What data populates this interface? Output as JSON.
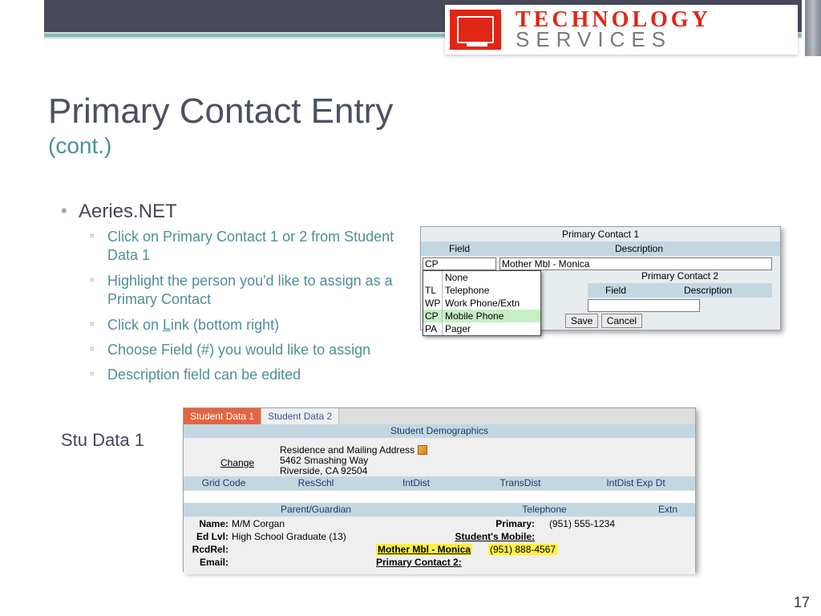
{
  "logo": {
    "line1": "TECHNOLOGY",
    "line2": "SERVICES"
  },
  "title": {
    "main": "Primary Contact Entry",
    "sub": "(cont.)"
  },
  "bullets": {
    "top": "Aeries.NET",
    "subs": [
      "Click on Primary Contact 1 or 2 from Student Data 1",
      "Highlight the person you'd like to assign as a Primary Contact",
      "Click on Link (bottom right)",
      "Choose Field (#) you would like to assign",
      "Description field can be edited"
    ]
  },
  "stu_label": "Stu Data 1",
  "inset1": {
    "pc1_title": "Primary Contact 1",
    "pc2_title": "Primary Contact 2",
    "col_field": "Field",
    "col_desc": "Description",
    "field_value": "CP",
    "desc_value": "Mother Mbl - Monica",
    "save": "Save",
    "cancel": "Cancel",
    "dropdown": [
      {
        "code": "",
        "label": "None"
      },
      {
        "code": "TL",
        "label": "Telephone"
      },
      {
        "code": "WP",
        "label": "Work Phone/Extn"
      },
      {
        "code": "CP",
        "label": "Mobile Phone"
      },
      {
        "code": "PA",
        "label": "Pager"
      }
    ]
  },
  "inset2": {
    "tabs": [
      "Student Data 1",
      "Student Data 2"
    ],
    "section_title": "Student Demographics",
    "change": "Change",
    "ram_label": "Residence and Mailing Address",
    "addr1": "5462 Smashing Way",
    "addr2": "Riverside, CA 92504",
    "cols5": [
      "Grid Code",
      "ResSchl",
      "IntDist",
      "TransDist",
      "IntDist Exp Dt"
    ],
    "pg_cols": [
      "Parent/Guardian",
      "Telephone",
      "Extn"
    ],
    "labels": {
      "name": "Name:",
      "edlvl": "Ed Lvl:",
      "rcdrel": "RcdRel:",
      "email": "Email:",
      "primary": "Primary:",
      "stu_mobile": "Student's Mobile:",
      "pc1": "Mother Mbl - Monica",
      "pc1_phone": "(951) 888-4567",
      "pc2": "Primary Contact 2:"
    },
    "vals": {
      "name": "M/M Corgan",
      "edlvl": "High School Graduate (13)",
      "primary": "(951) 555-1234"
    }
  },
  "page_number": "17"
}
